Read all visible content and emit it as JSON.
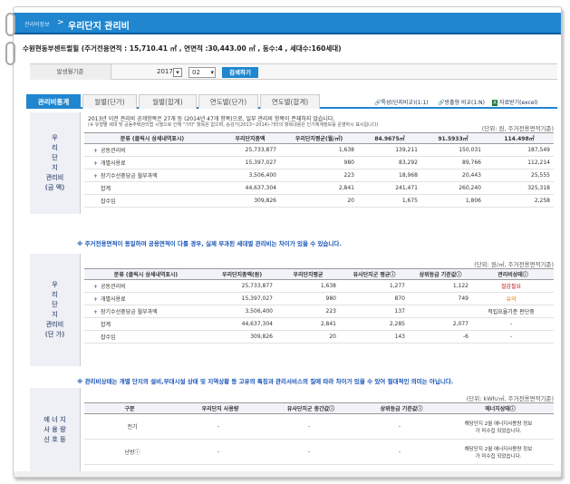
{
  "nav": {
    "crumb": "관리비정보",
    "separator": ">",
    "page_title": "우리단지 관리비"
  },
  "complex": {
    "heading": "수원현동부센트럴힐 (주거전용면적 : 15,710.41 ㎡ , 연면적 :30,443.00 ㎡ , 동수:4 , 세대수:160세대)"
  },
  "period": {
    "label": "발생월기준",
    "year": "2017",
    "month": "02",
    "button": "검색하기"
  },
  "tabs": [
    "관리비통계",
    "월별(단가)",
    "월별(합계)",
    "연도별(단가)",
    "연도별(합계)"
  ],
  "actions": {
    "compare_type": "특성(단지비교)(1:1)",
    "compare_many": "방출형 비교(1:N)",
    "excel": "자료받기(excel)"
  },
  "section1": {
    "side": [
      "우",
      "리",
      "단",
      "지",
      "관리비",
      "(금 액)"
    ],
    "note1": "2013년 이전 관리비 공개항목은 27개 등 (2014년 47개 항목)으로, 일부 관리비 항목이 존재하지 않습니다.",
    "note2": "(※ 유형별 세대 및 공동주택관리법 시행으로 인해 \"기타\" 항목은 없으며, 승강기(2013~2014)-기타의 항목내용은 인기체계정보를 운영하시 표시됩니다)",
    "unit": "(단위: 원, 주거전용면적기준)",
    "headers": [
      "분류 (클릭시 상세내역표시)",
      "우리단지총액",
      "우리단지평균(월/㎡)",
      "84.9675㎡",
      "91.5933㎡",
      "114.498㎡"
    ],
    "rows": [
      {
        "name": "공동관리비",
        "v": [
          "25,733,877",
          "1,638",
          "139,211",
          "150,031",
          "187,549"
        ]
      },
      {
        "name": "개별사용료",
        "v": [
          "15,397,027",
          "980",
          "83,292",
          "89,766",
          "112,214"
        ]
      },
      {
        "name": "장기수선충당금 월부과액",
        "v": [
          "3,506,400",
          "223",
          "18,968",
          "20,443",
          "25,555"
        ]
      },
      {
        "name": "합계",
        "v": [
          "44,637,304",
          "2,841",
          "241,471",
          "260,240",
          "325,318"
        ]
      },
      {
        "name": "잡수입",
        "v": [
          "309,826",
          "20",
          "1,675",
          "1,806",
          "2,258"
        ]
      }
    ]
  },
  "warn1": "※ 주거전용면적이 동일하여 공용면적이 다를 경우, 실제 부과된 세대별 관리비는 차이가 있을 수 있습니다.",
  "section2": {
    "side": [
      "우",
      "리",
      "단",
      "지",
      "관리비",
      "(단 가)"
    ],
    "unit": "(단위: 원/㎡, 주거전용면적기준)",
    "headers": [
      "분류 (클릭시 상세내역표시)",
      "우리단지총액(원)",
      "우리단지평균",
      "유사단지군 평균ⓘ",
      "상위등급 기준값ⓘ",
      "관리비상태ⓘ"
    ],
    "rows": [
      {
        "name": "공동관리비",
        "v": [
          "25,733,877",
          "1,638",
          "1,277",
          "1,122",
          "절감필요"
        ]
      },
      {
        "name": "개별사용료",
        "v": [
          "15,397,027",
          "980",
          "870",
          "749",
          "유의"
        ]
      },
      {
        "name": "장기수선충당금 월부과액",
        "v": [
          "3,506,400",
          "223",
          "137",
          "",
          "적립요율기준 판단중"
        ]
      },
      {
        "name": "합계",
        "v": [
          "44,637,304",
          "2,841",
          "2,285",
          "2,077",
          "-"
        ]
      },
      {
        "name": "잡수입",
        "v": [
          "309,826",
          "20",
          "143",
          "-6",
          "-"
        ]
      }
    ]
  },
  "warn2": "※ 관리비상태는 개별 단지의 설비,부대시설 상태 및 지역상황 등 고유의 특징과 관리서비스의 질에 따라 차이가 있을 수 있어 절대적인 의미는 아닙니다.",
  "section3": {
    "side": [
      "에 너 지",
      "사 용 량",
      "신 호 등"
    ],
    "unit": "(단위: kWh/㎡, 주거전용면적기준)",
    "headers": [
      "구분",
      "우리단지 사용량",
      "유사단지군 중간값ⓘ",
      "상위등급 기준값ⓘ",
      "에너지상태ⓘ"
    ],
    "rows": [
      {
        "name": "전기",
        "v": [
          "-",
          "-",
          "-",
          "해당단지 2월 에너지사용량 정보\n가 미수집 되었습니다."
        ]
      },
      {
        "name": "난방ⓘ",
        "v": [
          "-",
          "-",
          "-",
          "해당단지 2월 에너지사용량 정보\n가 미수집 되었습니다."
        ]
      }
    ]
  },
  "colors": {
    "accent": "#1f86cf",
    "warn": "#1a56b8",
    "alert": "#c01010"
  }
}
